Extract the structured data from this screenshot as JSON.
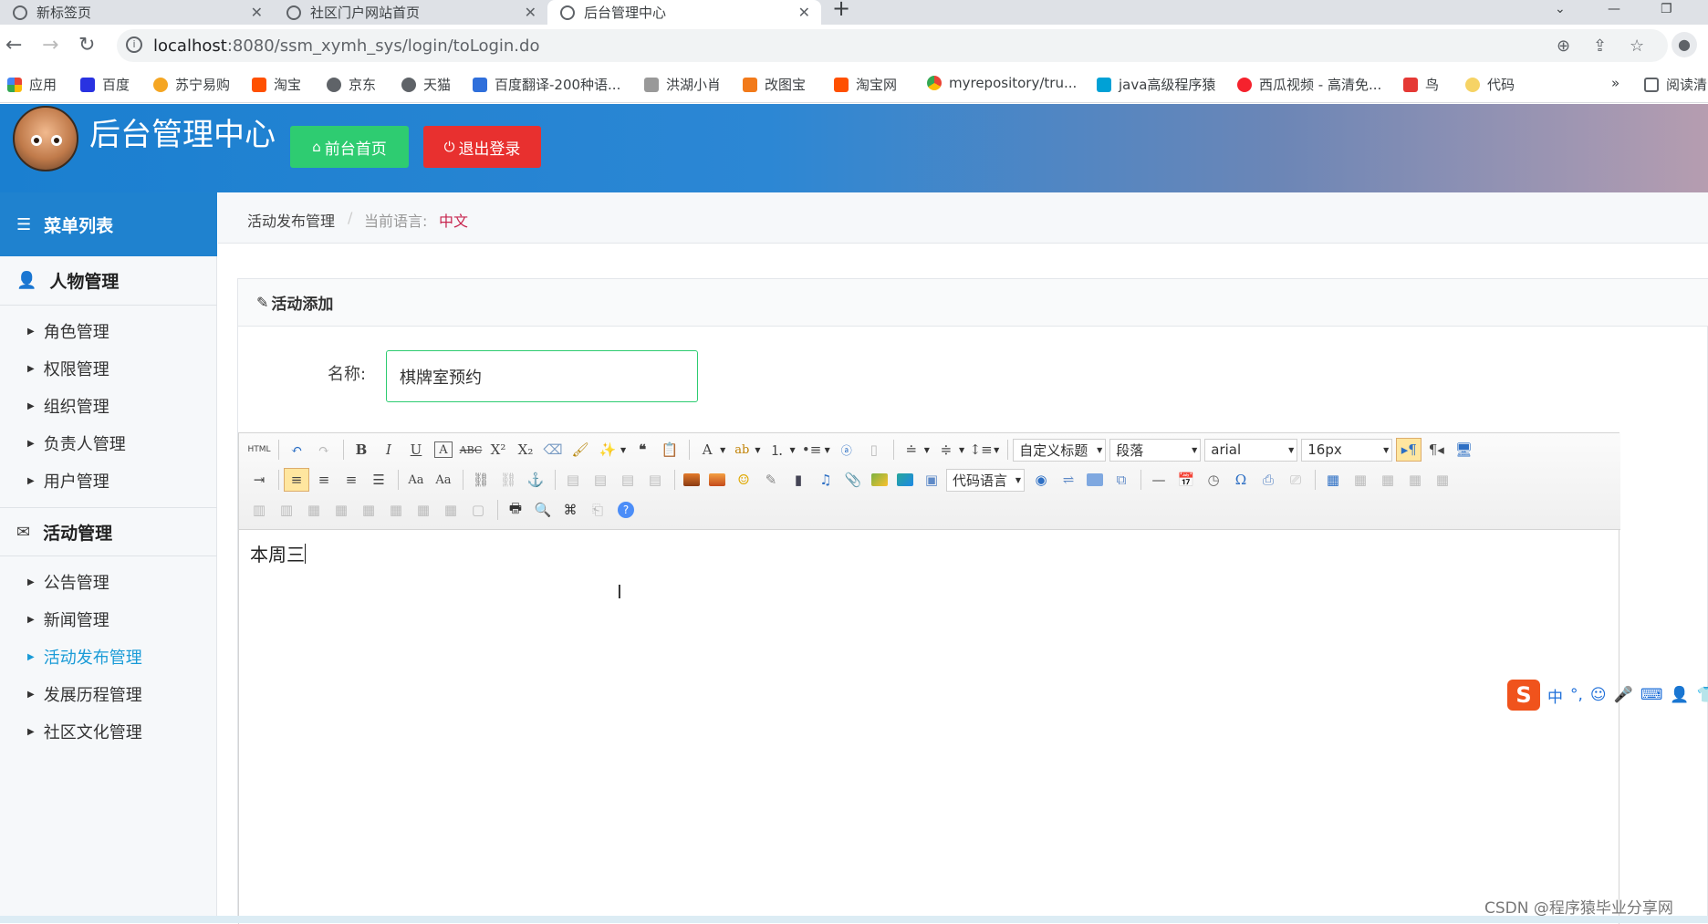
{
  "browser": {
    "tabs": [
      {
        "title": "新标签页"
      },
      {
        "title": "社区门户网站首页"
      },
      {
        "title": "后台管理中心"
      }
    ],
    "url_host": "localhost",
    "url_rest": ":8080/ssm_xymh_sys/login/toLogin.do",
    "bookmarks": [
      {
        "label": "应用",
        "color": "#ea4335"
      },
      {
        "label": "百度",
        "color": "#2932e1"
      },
      {
        "label": "苏宁易购",
        "color": "#f5a623"
      },
      {
        "label": "淘宝",
        "color": "#ff5000"
      },
      {
        "label": "京东",
        "color": "#5f6368"
      },
      {
        "label": "天猫",
        "color": "#5f6368"
      },
      {
        "label": "百度翻译-200种语...",
        "color": "#2f6fdb"
      },
      {
        "label": "洪湖小肖",
        "color": "#999999"
      },
      {
        "label": "改图宝",
        "color": "#f27a1a"
      },
      {
        "label": "淘宝网",
        "color": "#ff5000"
      },
      {
        "label": "myrepository/tru...",
        "color": "#34a853"
      },
      {
        "label": "java高级程序猿",
        "color": "#00a1d6"
      },
      {
        "label": "西瓜视频 - 高清免...",
        "color": "#f5222d"
      },
      {
        "label": "鸟",
        "color": "#e53935"
      },
      {
        "label": "代码",
        "color": "#f6d365"
      }
    ],
    "bookmarks_more": "»",
    "reading_list": "阅读清"
  },
  "header": {
    "title": "后台管理中心",
    "home_button": "前台首页",
    "logout_button": "退出登录",
    "colors": {
      "home": "#2ecc71",
      "logout": "#e8302f"
    }
  },
  "sidebar": {
    "title": "菜单列表",
    "groups": [
      {
        "label": "人物管理",
        "items": [
          "角色管理",
          "权限管理",
          "组织管理",
          "负责人管理",
          "用户管理"
        ]
      },
      {
        "label": "活动管理",
        "items": [
          "公告管理",
          "新闻管理",
          "活动发布管理",
          "发展历程管理",
          "社区文化管理"
        ]
      }
    ],
    "active_item": "活动发布管理"
  },
  "breadcrumb": {
    "section": "活动发布管理",
    "lang_label": "当前语言:",
    "lang_value": "中文"
  },
  "form": {
    "panel_title": "活动添加",
    "name_label": "名称:",
    "name_value": "棋牌室预约"
  },
  "editor": {
    "selects": {
      "custom_title": "自定义标题",
      "paragraph": "段落",
      "font_family": "arial",
      "font_size": "16px",
      "code_language": "代码语言"
    },
    "content": "本周三"
  },
  "ime": {
    "lang": "中",
    "punct": "°,"
  },
  "watermark": "CSDN @程序猿毕业分享网"
}
